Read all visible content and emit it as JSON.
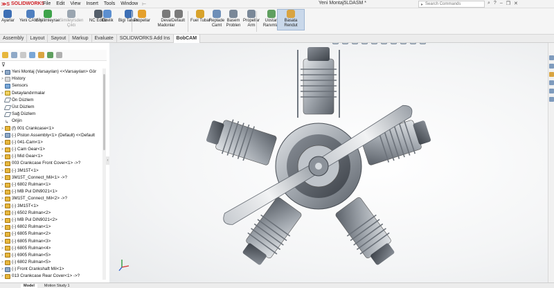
{
  "app": {
    "brand": "SOLIDWORKS",
    "doc_title": "Yeni Montaj5LDASM *",
    "menus": [
      "File",
      "Edit",
      "View",
      "Insert",
      "Tools",
      "Window"
    ],
    "search_placeholder": "Search Commands"
  },
  "ribbon": {
    "buttons": [
      {
        "label": "Ayarlar",
        "icon": "settings-icon",
        "state": "normal",
        "color": "#3d6fb5"
      },
      {
        "label": "Yeni CAM İş",
        "icon": "new-cam-job-icon",
        "state": "normal",
        "color": "#4f7fbf"
      },
      {
        "label": "Smilimleyrae",
        "icon": "simulate-icon",
        "state": "normal",
        "color": "#3ea34a"
      },
      {
        "label": "Simileyrsden Çıktı",
        "icon": "simulate-output-icon",
        "state": "dim",
        "color": "#9aa5b0"
      },
      {
        "label": "NC Editör",
        "icon": "nc-editor-icon",
        "state": "normal",
        "color": "#555f6b"
      },
      {
        "label": "Özelik",
        "icon": "properties-icon",
        "state": "normal",
        "color": "#5c8fd0"
      },
      {
        "label": "Bigi Tabanı",
        "icon": "info-base-icon",
        "state": "normal",
        "color": "#3d6fb5"
      },
      {
        "label": "Propellar",
        "icon": "propeller-icon",
        "state": "normal",
        "color": "#e5a02b"
      },
      {
        "label": "Deval Madonlar",
        "icon": "gear-icon",
        "state": "normal",
        "color": "#7a7a7a"
      },
      {
        "label": "Default",
        "icon": "default-icon",
        "state": "normal",
        "color": "#7a7a7a"
      },
      {
        "label": "Fuel Tubar",
        "icon": "fuel-tube-icon",
        "state": "normal",
        "color": "#d8a32c"
      },
      {
        "label": "Replade Camt",
        "icon": "replace-icon",
        "state": "normal",
        "color": "#6e8fb8"
      },
      {
        "label": "Basem Problen",
        "icon": "problem-icon",
        "state": "normal",
        "color": "#7a8898"
      },
      {
        "label": "Propellar Arm",
        "icon": "propeller-arm-icon",
        "state": "normal",
        "color": "#7a8898"
      },
      {
        "label": "Uostan Ranımlar",
        "icon": "image-icon",
        "state": "normal",
        "color": "#5f9f5f"
      },
      {
        "label": "Basata Rendut",
        "icon": "render-icon",
        "state": "active",
        "color": "#d9a441"
      }
    ]
  },
  "tabs": [
    "Assembly",
    "Layout",
    "Sayout",
    "Markup",
    "Evaluate",
    "SOLIDWORKS Add Ins",
    "BobCAM"
  ],
  "active_tab": "BobCAM",
  "tree": {
    "root": "Yeni Montaj (Varsayılan) <<Varsayılan> Gör",
    "items": [
      {
        "label": "History",
        "icon": "folder",
        "exp": ">"
      },
      {
        "label": "Sensors",
        "icon": "sensor",
        "exp": ""
      },
      {
        "label": "Detaylandırmalar",
        "icon": "annot",
        "exp": ">"
      },
      {
        "label": "Ön Düzlem",
        "icon": "plane",
        "exp": ""
      },
      {
        "label": "Üst Düzlem",
        "icon": "plane",
        "exp": ""
      },
      {
        "label": "Sağ Düzlem",
        "icon": "plane",
        "exp": ""
      },
      {
        "label": "Orijin",
        "icon": "origin",
        "exp": ""
      },
      {
        "label": "(f) 001 Crankcase<1>",
        "icon": "part",
        "exp": ">"
      },
      {
        "label": "(-) Piston Assembly<1> (Default) <<Default",
        "icon": "asm",
        "exp": ">"
      },
      {
        "label": "(-) 041-Cam<1>",
        "icon": "part",
        "exp": ">"
      },
      {
        "label": "(-) Cam Gear<1>",
        "icon": "part",
        "exp": ">"
      },
      {
        "label": "(-) Mid Gear<1>",
        "icon": "part",
        "exp": ">"
      },
      {
        "label": "003 Crankcase Front Cover<1> ->?",
        "icon": "part",
        "exp": ">"
      },
      {
        "label": "(-) 3M15T<1>",
        "icon": "part",
        "exp": ">"
      },
      {
        "label": "3M15T_Connect_Mil<1> ->?",
        "icon": "part",
        "exp": ">"
      },
      {
        "label": "(-) 6802 Rulman<1>",
        "icon": "part",
        "exp": ">"
      },
      {
        "label": "(-) MB Pul DIN9021<1>",
        "icon": "part",
        "exp": ">"
      },
      {
        "label": "3M15T_Connect_Mil<2> ->?",
        "icon": "part",
        "exp": ">"
      },
      {
        "label": "(-) 3M15T<1>",
        "icon": "part",
        "exp": ">"
      },
      {
        "label": "(-) 6502 Rulman<2>",
        "icon": "part",
        "exp": ">"
      },
      {
        "label": "(-) MB Pul DIN9021<2>",
        "icon": "part",
        "exp": ">"
      },
      {
        "label": "(-) 6802 Rulman<1>",
        "icon": "part",
        "exp": ">"
      },
      {
        "label": "(-) 6805 Rulman<2>",
        "icon": "part",
        "exp": ">"
      },
      {
        "label": "(-) 6805 Rulman<3>",
        "icon": "part",
        "exp": ">"
      },
      {
        "label": "(-) 6805 Rulman<4>",
        "icon": "part",
        "exp": ">"
      },
      {
        "label": "(-) 6905 Rulman<5>",
        "icon": "part",
        "exp": ">"
      },
      {
        "label": "(-) 6802 Rulman<5>",
        "icon": "part",
        "exp": ">"
      },
      {
        "label": "(-) Front Crankshaft Mil<1>",
        "icon": "asm",
        "exp": ">"
      },
      {
        "label": "013 Crankcase Rear Cover<1> ->?",
        "icon": "part",
        "exp": ">"
      }
    ]
  },
  "status_tabs": [
    "Model",
    "Motion Study 1"
  ],
  "colors": {
    "brand": "#d01f25",
    "active_tab_bg": "#ffffff",
    "viewport_bg": "#f4f5f6",
    "metal": "#a9aeb4"
  }
}
